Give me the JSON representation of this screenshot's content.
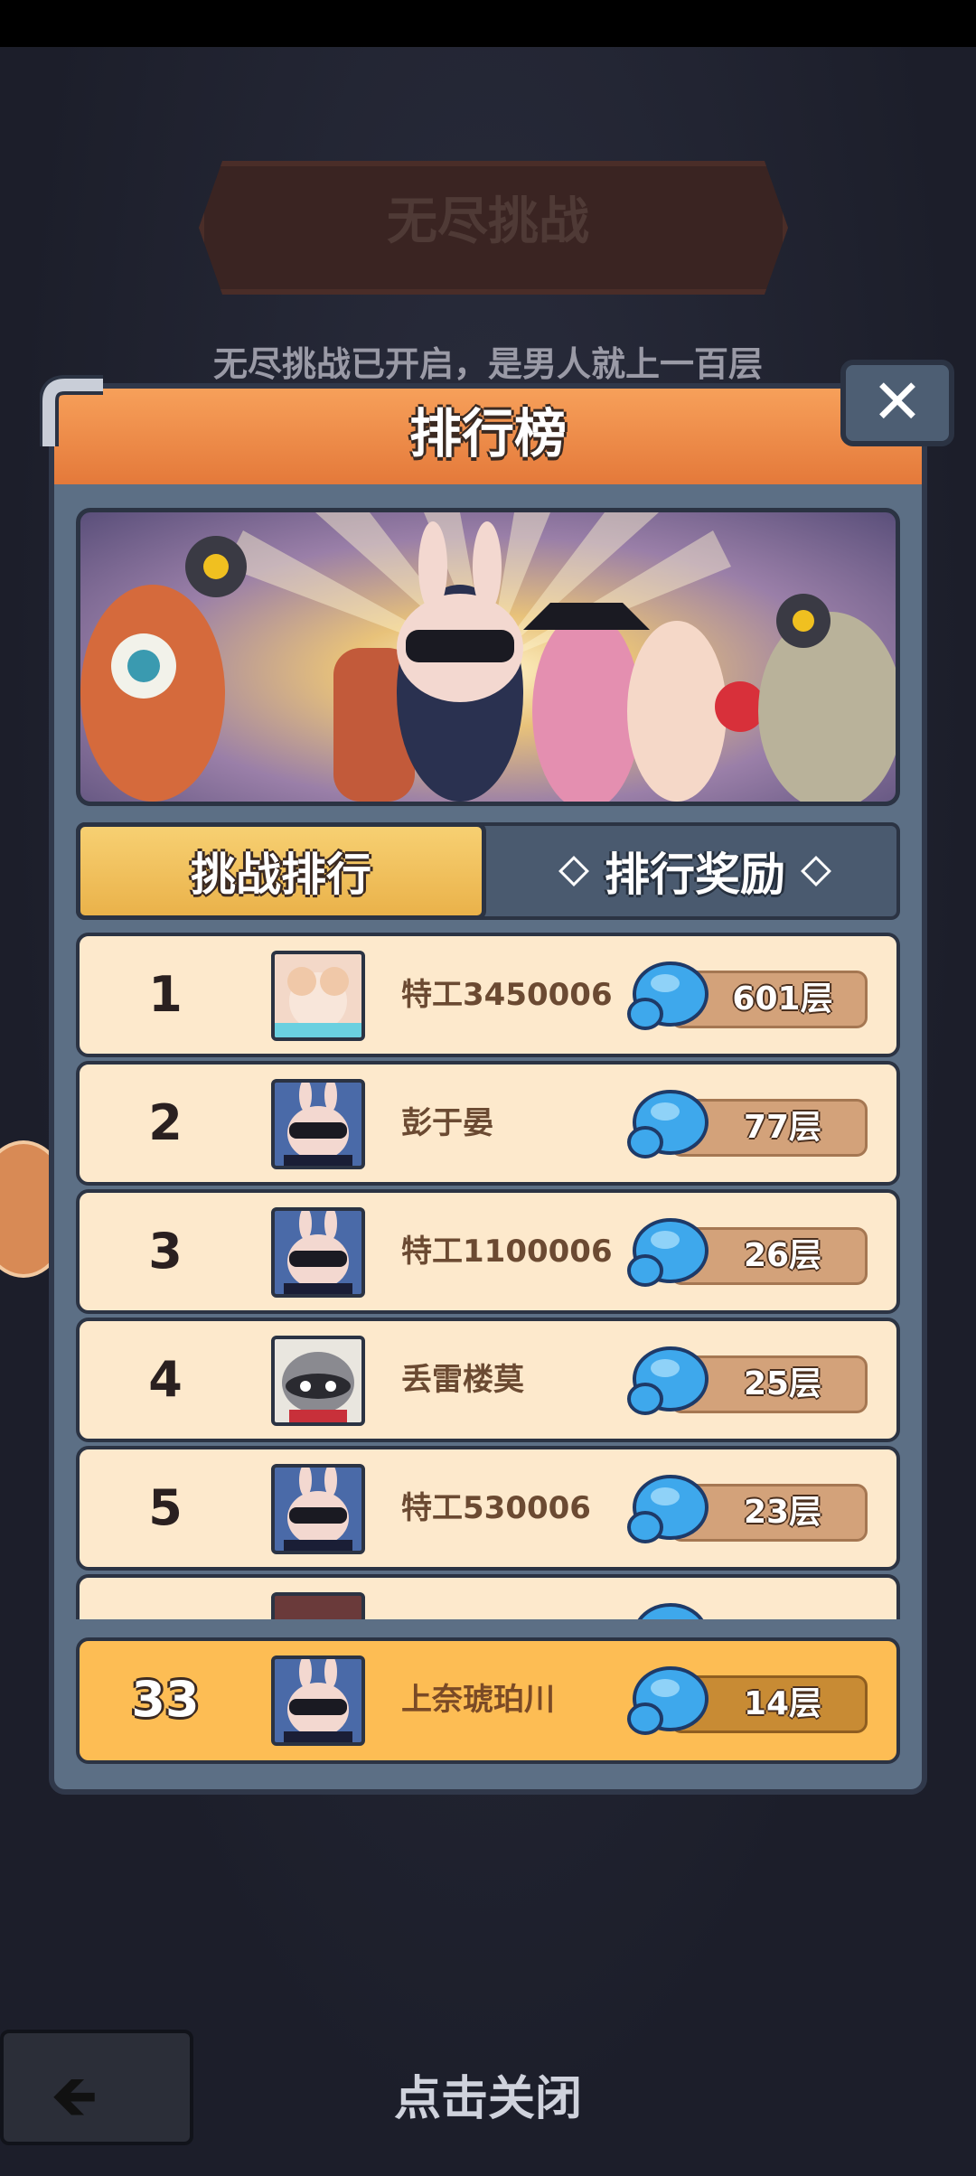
{
  "background": {
    "title": "无尽挑战",
    "notice": "无尽挑战已开启，是男人就上一百层"
  },
  "modal": {
    "title": "排行榜",
    "close_icon": "close-icon",
    "tabs": [
      {
        "label": "挑战排行",
        "active": true
      },
      {
        "label": "排行奖励",
        "active": false
      }
    ]
  },
  "ranking": [
    {
      "rank": "1",
      "name": "特工3450006",
      "score": "601层",
      "avatar": "girl-avatar"
    },
    {
      "rank": "2",
      "name": "彭于晏",
      "score": "77层",
      "avatar": "rabbit-avatar"
    },
    {
      "rank": "3",
      "name": "特工1100006",
      "score": "26层",
      "avatar": "rabbit-avatar"
    },
    {
      "rank": "4",
      "name": "丢雷楼莫",
      "score": "25层",
      "avatar": "raccoon-avatar"
    },
    {
      "rank": "5",
      "name": "特工530006",
      "score": "23层",
      "avatar": "rabbit-avatar"
    }
  ],
  "self": {
    "rank": "33",
    "name": "上奈琥珀川",
    "score": "14层",
    "avatar": "rabbit-avatar"
  },
  "footer": {
    "close_hint": "点击关闭"
  },
  "colors": {
    "header": "#e4793a",
    "row": "#fde9cc",
    "self_row": "#fdbd54",
    "tab_active": "#eab24a"
  }
}
